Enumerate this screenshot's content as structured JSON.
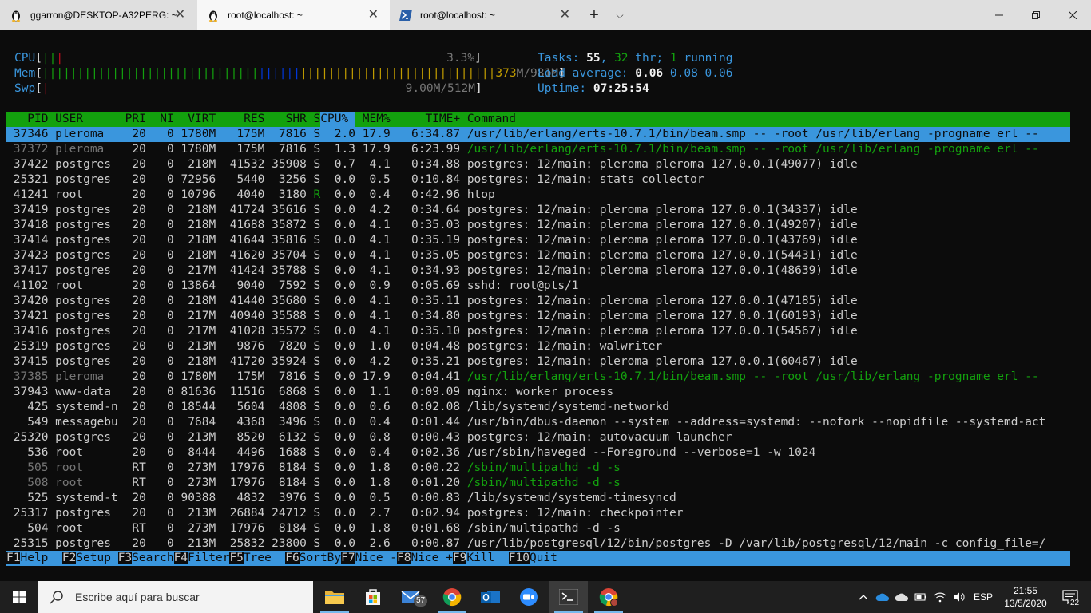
{
  "tabs": [
    {
      "label": "ggarron@DESKTOP-A32PERG: ~",
      "icon": "tux-icon",
      "active": false
    },
    {
      "label": "root@localhost: ~",
      "icon": "tux-icon",
      "active": true
    },
    {
      "label": "root@localhost: ~",
      "icon": "powershell-icon",
      "active": false
    }
  ],
  "meters": {
    "cpu_label": "CPU",
    "cpu_value": "3.3%",
    "mem_label": "Mem",
    "mem_used": "373",
    "mem_rest": "M/981M",
    "swp_label": "Swp",
    "swp_value": "9.00M/512M"
  },
  "stats": {
    "tasks_label": "Tasks:",
    "tasks": "55",
    "threads": "32",
    "thr_label": "thr;",
    "running": "1",
    "running_label": "running",
    "load_label": "Load average:",
    "load1": "0.06",
    "load5": "0.08",
    "load15": "0.06",
    "uptime_label": "Uptime:",
    "uptime": "07:25:54"
  },
  "columns": [
    "PID",
    "USER",
    "PRI",
    "NI",
    "VIRT",
    "RES",
    "SHR",
    "S",
    "CPU%",
    "MEM%",
    "TIME+",
    "Command"
  ],
  "processes": [
    {
      "pid": "37346",
      "user": "pleroma",
      "pri": "20",
      "ni": "0",
      "virt": "1780M",
      "res": "175M",
      "shr": "7816",
      "s": "S",
      "cpu": "2.0",
      "mem": "17.9",
      "time": "6:34.87",
      "cmd": "/usr/lib/erlang/erts-10.7.1/bin/beam.smp -- -root /usr/lib/erlang -progname erl --",
      "thread": false
    },
    {
      "pid": "37372",
      "user": "pleroma",
      "pri": "20",
      "ni": "0",
      "virt": "1780M",
      "res": "175M",
      "shr": "7816",
      "s": "S",
      "cpu": "1.3",
      "mem": "17.9",
      "time": "6:23.99",
      "cmd": "/usr/lib/erlang/erts-10.7.1/bin/beam.smp -- -root /usr/lib/erlang -progname erl --",
      "thread": true
    },
    {
      "pid": "37422",
      "user": "postgres",
      "pri": "20",
      "ni": "0",
      "virt": "218M",
      "res": "41532",
      "shr": "35908",
      "s": "S",
      "cpu": "0.7",
      "mem": "4.1",
      "time": "0:34.88",
      "cmd": "postgres: 12/main: pleroma pleroma 127.0.0.1(49077) idle",
      "thread": false
    },
    {
      "pid": "25321",
      "user": "postgres",
      "pri": "20",
      "ni": "0",
      "virt": "72956",
      "res": "5440",
      "shr": "3256",
      "s": "S",
      "cpu": "0.0",
      "mem": "0.5",
      "time": "0:10.84",
      "cmd": "postgres: 12/main: stats collector",
      "thread": false
    },
    {
      "pid": "41241",
      "user": "root",
      "pri": "20",
      "ni": "0",
      "virt": "10796",
      "res": "4040",
      "shr": "3180",
      "s": "R",
      "cpu": "0.0",
      "mem": "0.4",
      "time": "0:42.96",
      "cmd": "htop",
      "thread": false
    },
    {
      "pid": "37419",
      "user": "postgres",
      "pri": "20",
      "ni": "0",
      "virt": "218M",
      "res": "41724",
      "shr": "35616",
      "s": "S",
      "cpu": "0.0",
      "mem": "4.2",
      "time": "0:34.64",
      "cmd": "postgres: 12/main: pleroma pleroma 127.0.0.1(34337) idle",
      "thread": false
    },
    {
      "pid": "37418",
      "user": "postgres",
      "pri": "20",
      "ni": "0",
      "virt": "218M",
      "res": "41688",
      "shr": "35872",
      "s": "S",
      "cpu": "0.0",
      "mem": "4.1",
      "time": "0:35.03",
      "cmd": "postgres: 12/main: pleroma pleroma 127.0.0.1(49207) idle",
      "thread": false
    },
    {
      "pid": "37414",
      "user": "postgres",
      "pri": "20",
      "ni": "0",
      "virt": "218M",
      "res": "41644",
      "shr": "35816",
      "s": "S",
      "cpu": "0.0",
      "mem": "4.1",
      "time": "0:35.19",
      "cmd": "postgres: 12/main: pleroma pleroma 127.0.0.1(43769) idle",
      "thread": false
    },
    {
      "pid": "37423",
      "user": "postgres",
      "pri": "20",
      "ni": "0",
      "virt": "218M",
      "res": "41620",
      "shr": "35704",
      "s": "S",
      "cpu": "0.0",
      "mem": "4.1",
      "time": "0:35.05",
      "cmd": "postgres: 12/main: pleroma pleroma 127.0.0.1(54431) idle",
      "thread": false
    },
    {
      "pid": "37417",
      "user": "postgres",
      "pri": "20",
      "ni": "0",
      "virt": "217M",
      "res": "41424",
      "shr": "35788",
      "s": "S",
      "cpu": "0.0",
      "mem": "4.1",
      "time": "0:34.93",
      "cmd": "postgres: 12/main: pleroma pleroma 127.0.0.1(48639) idle",
      "thread": false
    },
    {
      "pid": "41102",
      "user": "root",
      "pri": "20",
      "ni": "0",
      "virt": "13864",
      "res": "9040",
      "shr": "7592",
      "s": "S",
      "cpu": "0.0",
      "mem": "0.9",
      "time": "0:05.69",
      "cmd": "sshd: root@pts/1",
      "thread": false
    },
    {
      "pid": "37420",
      "user": "postgres",
      "pri": "20",
      "ni": "0",
      "virt": "218M",
      "res": "41440",
      "shr": "35680",
      "s": "S",
      "cpu": "0.0",
      "mem": "4.1",
      "time": "0:35.11",
      "cmd": "postgres: 12/main: pleroma pleroma 127.0.0.1(47185) idle",
      "thread": false
    },
    {
      "pid": "37421",
      "user": "postgres",
      "pri": "20",
      "ni": "0",
      "virt": "217M",
      "res": "40940",
      "shr": "35588",
      "s": "S",
      "cpu": "0.0",
      "mem": "4.1",
      "time": "0:34.80",
      "cmd": "postgres: 12/main: pleroma pleroma 127.0.0.1(60193) idle",
      "thread": false
    },
    {
      "pid": "37416",
      "user": "postgres",
      "pri": "20",
      "ni": "0",
      "virt": "217M",
      "res": "41028",
      "shr": "35572",
      "s": "S",
      "cpu": "0.0",
      "mem": "4.1",
      "time": "0:35.10",
      "cmd": "postgres: 12/main: pleroma pleroma 127.0.0.1(54567) idle",
      "thread": false
    },
    {
      "pid": "25319",
      "user": "postgres",
      "pri": "20",
      "ni": "0",
      "virt": "213M",
      "res": "9876",
      "shr": "7820",
      "s": "S",
      "cpu": "0.0",
      "mem": "1.0",
      "time": "0:04.48",
      "cmd": "postgres: 12/main: walwriter",
      "thread": false
    },
    {
      "pid": "37415",
      "user": "postgres",
      "pri": "20",
      "ni": "0",
      "virt": "218M",
      "res": "41720",
      "shr": "35924",
      "s": "S",
      "cpu": "0.0",
      "mem": "4.2",
      "time": "0:35.21",
      "cmd": "postgres: 12/main: pleroma pleroma 127.0.0.1(60467) idle",
      "thread": false
    },
    {
      "pid": "37385",
      "user": "pleroma",
      "pri": "20",
      "ni": "0",
      "virt": "1780M",
      "res": "175M",
      "shr": "7816",
      "s": "S",
      "cpu": "0.0",
      "mem": "17.9",
      "time": "0:04.41",
      "cmd": "/usr/lib/erlang/erts-10.7.1/bin/beam.smp -- -root /usr/lib/erlang -progname erl --",
      "thread": true
    },
    {
      "pid": "37943",
      "user": "www-data",
      "pri": "20",
      "ni": "0",
      "virt": "81636",
      "res": "11516",
      "shr": "6868",
      "s": "S",
      "cpu": "0.0",
      "mem": "1.1",
      "time": "0:09.09",
      "cmd": "nginx: worker process",
      "thread": false
    },
    {
      "pid": "425",
      "user": "systemd-n",
      "pri": "20",
      "ni": "0",
      "virt": "18544",
      "res": "5604",
      "shr": "4808",
      "s": "S",
      "cpu": "0.0",
      "mem": "0.6",
      "time": "0:02.08",
      "cmd": "/lib/systemd/systemd-networkd",
      "thread": false
    },
    {
      "pid": "549",
      "user": "messagebu",
      "pri": "20",
      "ni": "0",
      "virt": "7684",
      "res": "4368",
      "shr": "3496",
      "s": "S",
      "cpu": "0.0",
      "mem": "0.4",
      "time": "0:01.44",
      "cmd": "/usr/bin/dbus-daemon --system --address=systemd: --nofork --nopidfile --systemd-act",
      "thread": false
    },
    {
      "pid": "25320",
      "user": "postgres",
      "pri": "20",
      "ni": "0",
      "virt": "213M",
      "res": "8520",
      "shr": "6132",
      "s": "S",
      "cpu": "0.0",
      "mem": "0.8",
      "time": "0:00.43",
      "cmd": "postgres: 12/main: autovacuum launcher",
      "thread": false
    },
    {
      "pid": "536",
      "user": "root",
      "pri": "20",
      "ni": "0",
      "virt": "8444",
      "res": "4496",
      "shr": "1688",
      "s": "S",
      "cpu": "0.0",
      "mem": "0.4",
      "time": "0:02.36",
      "cmd": "/usr/sbin/haveged --Foreground --verbose=1 -w 1024",
      "thread": false
    },
    {
      "pid": "505",
      "user": "root",
      "pri": "RT",
      "ni": "0",
      "virt": "273M",
      "res": "17976",
      "shr": "8184",
      "s": "S",
      "cpu": "0.0",
      "mem": "1.8",
      "time": "0:00.22",
      "cmd": "/sbin/multipathd -d -s",
      "thread": true
    },
    {
      "pid": "508",
      "user": "root",
      "pri": "RT",
      "ni": "0",
      "virt": "273M",
      "res": "17976",
      "shr": "8184",
      "s": "S",
      "cpu": "0.0",
      "mem": "1.8",
      "time": "0:01.20",
      "cmd": "/sbin/multipathd -d -s",
      "thread": true
    },
    {
      "pid": "525",
      "user": "systemd-t",
      "pri": "20",
      "ni": "0",
      "virt": "90388",
      "res": "4832",
      "shr": "3976",
      "s": "S",
      "cpu": "0.0",
      "mem": "0.5",
      "time": "0:00.83",
      "cmd": "/lib/systemd/systemd-timesyncd",
      "thread": false
    },
    {
      "pid": "25317",
      "user": "postgres",
      "pri": "20",
      "ni": "0",
      "virt": "213M",
      "res": "26884",
      "shr": "24712",
      "s": "S",
      "cpu": "0.0",
      "mem": "2.7",
      "time": "0:02.94",
      "cmd": "postgres: 12/main: checkpointer",
      "thread": false
    },
    {
      "pid": "504",
      "user": "root",
      "pri": "RT",
      "ni": "0",
      "virt": "273M",
      "res": "17976",
      "shr": "8184",
      "s": "S",
      "cpu": "0.0",
      "mem": "1.8",
      "time": "0:01.68",
      "cmd": "/sbin/multipathd -d -s",
      "thread": false
    },
    {
      "pid": "25315",
      "user": "postgres",
      "pri": "20",
      "ni": "0",
      "virt": "213M",
      "res": "25832",
      "shr": "23800",
      "s": "S",
      "cpu": "0.0",
      "mem": "2.6",
      "time": "0:00.87",
      "cmd": "/usr/lib/postgresql/12/bin/postgres -D /var/lib/postgresql/12/main -c config_file=/",
      "thread": false
    }
  ],
  "fkeys": [
    {
      "key": "F1",
      "label": "Help  "
    },
    {
      "key": "F2",
      "label": "Setup "
    },
    {
      "key": "F3",
      "label": "Search"
    },
    {
      "key": "F4",
      "label": "Filter"
    },
    {
      "key": "F5",
      "label": "Tree  "
    },
    {
      "key": "F6",
      "label": "SortBy"
    },
    {
      "key": "F7",
      "label": "Nice -"
    },
    {
      "key": "F8",
      "label": "Nice +"
    },
    {
      "key": "F9",
      "label": "Kill  "
    },
    {
      "key": "F10",
      "label": "Quit"
    }
  ],
  "taskbar": {
    "search_placeholder": "Escribe aquí para buscar",
    "mail_badge": "57",
    "lang": "ESP",
    "time": "21:55",
    "date": "13/5/2020",
    "notif_count": "22"
  },
  "colors": {
    "terminal_bg": "#0c0c0c",
    "header_green": "#13a10e",
    "selection_blue": "#3a96dd",
    "taskbar_bg": "#1f1f1f"
  }
}
